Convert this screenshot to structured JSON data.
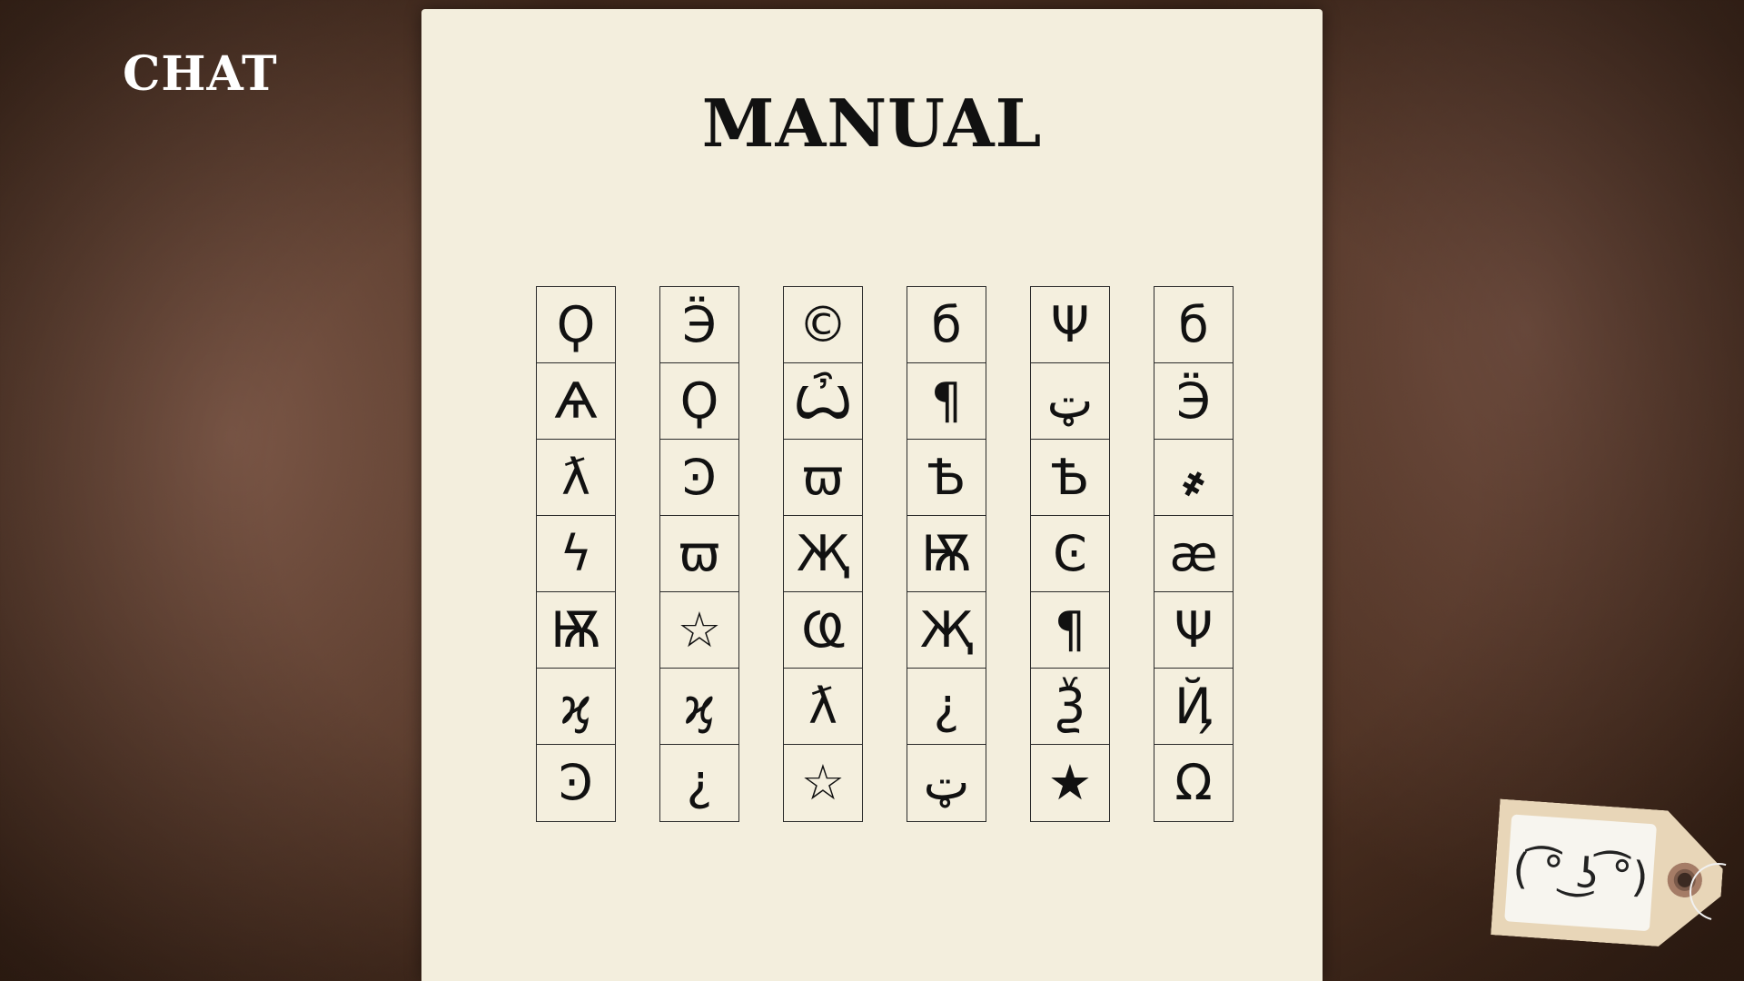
{
  "chat": {
    "label": "CHAT"
  },
  "manual": {
    "title": "MANUAL",
    "columns": [
      {
        "symbols": [
          "Ϙ",
          "Ӭ",
          "©",
          "б",
          "Ψ",
          "б"
        ]
      },
      {
        "symbols": [
          "Ѧ",
          "Ϙ",
          "Ѽ",
          "¶",
          "ټ",
          "Ӭ"
        ]
      },
      {
        "symbols": [
          "ƛ",
          "Ͽ",
          "ϖ",
          "Ѣ",
          "Ѣ",
          "҂"
        ]
      },
      {
        "symbols": [
          "ϟ",
          "ϖ",
          "Җ",
          "Ѭ",
          "Ͼ",
          "æ"
        ]
      },
      {
        "symbols": [
          "Ѭ",
          "☆",
          "Ҩ",
          "Җ",
          "¶",
          "Ψ"
        ]
      },
      {
        "symbols": [
          "ϗ",
          "ϗ",
          "ƛ",
          "¿",
          "Ѯ",
          "Ҋ"
        ]
      },
      {
        "symbols": [
          "Ͽ",
          "¿",
          "☆",
          "ټ",
          "★",
          "Ω"
        ]
      }
    ]
  },
  "tag": {
    "face": "( ͡° ͜ʖ ͡°)"
  },
  "colors": {
    "paper": "#f3eedd",
    "background": "#5a3b2c",
    "ink": "#111111",
    "tag": "#e8d6b8"
  }
}
